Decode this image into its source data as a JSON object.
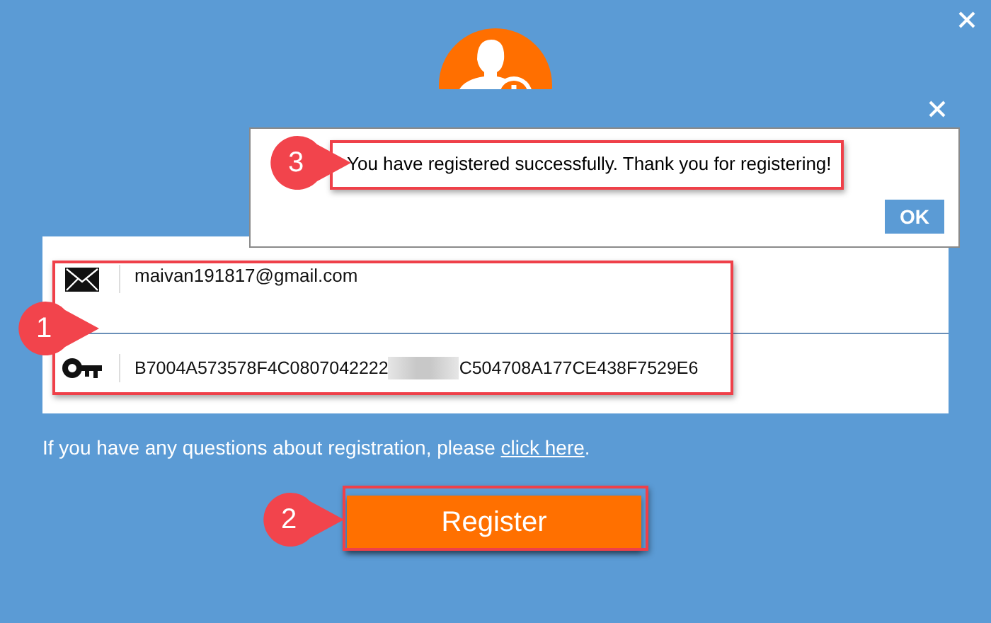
{
  "dialog": {
    "message": "You have registered successfully. Thank you for registering!",
    "ok_button": "OK"
  },
  "form": {
    "email": "maivan191817@gmail.com",
    "key_start": "B7004A573578F4C0807042222",
    "key_end": "C504708A177CE438F7529E6"
  },
  "help": {
    "text": "If you have any questions about registration, please ",
    "link": "click here",
    "end": "."
  },
  "register_button": "Register",
  "callouts": [
    {
      "number": "3"
    },
    {
      "number": "1"
    },
    {
      "number": "2"
    }
  ]
}
